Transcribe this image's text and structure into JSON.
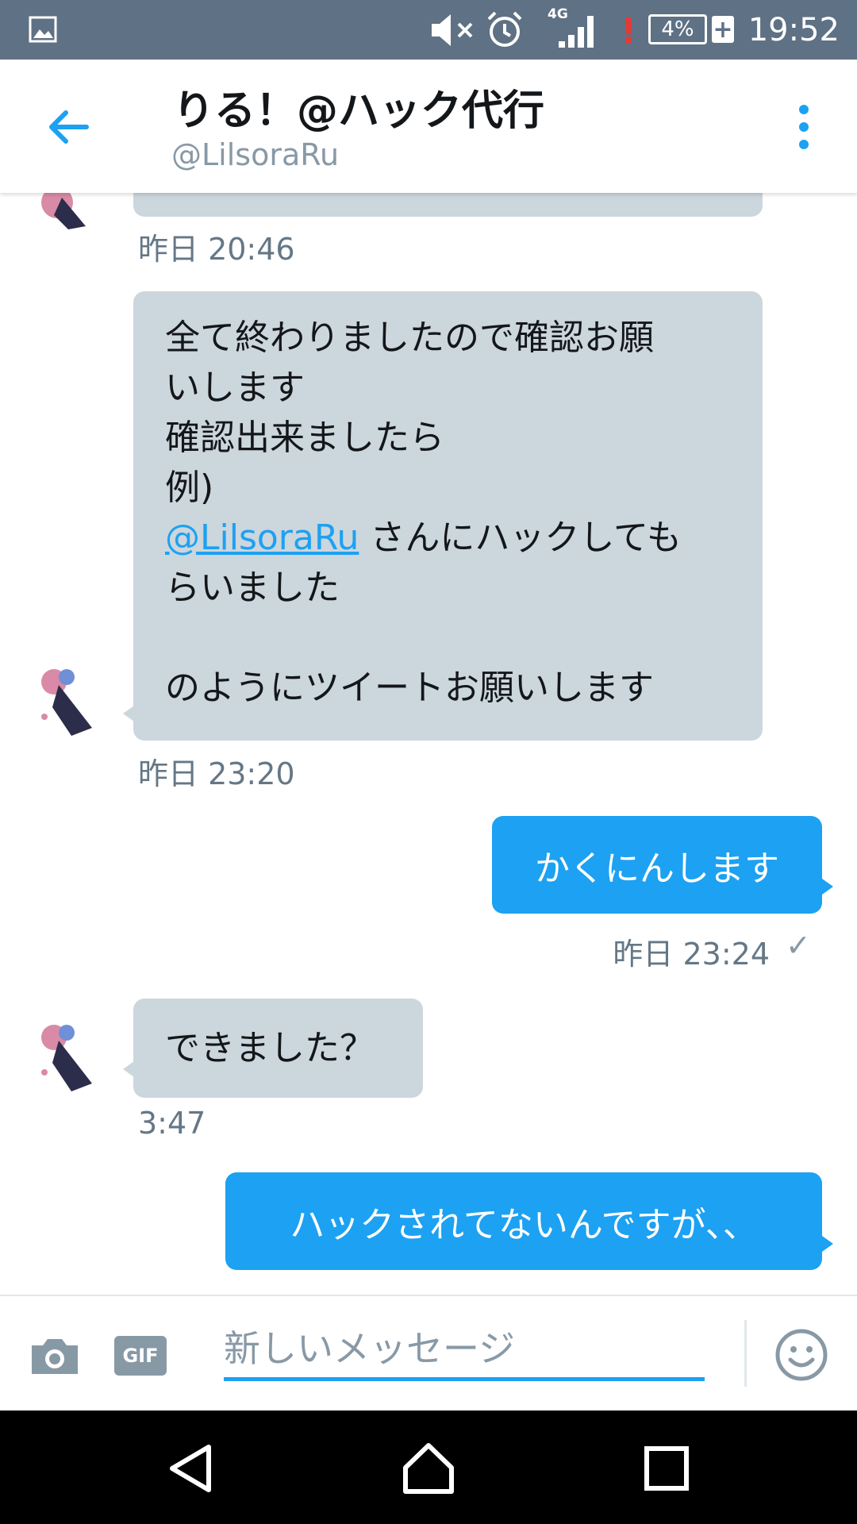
{
  "status_bar": {
    "network": "4G",
    "battery": "4%",
    "battery_charging": "+",
    "alert": "!",
    "time": "19:52"
  },
  "header": {
    "title": "りる！@ハック代行",
    "handle": "@LilsoraRu"
  },
  "messages": [
    {
      "direction": "incoming",
      "lines": [
        "全て終わりましたので確認お願",
        "いします",
        "確認出来ましたら",
        "例)"
      ],
      "mention": "@LilsoraRu",
      "after_mention": "さんにハックしても",
      "lines_after": [
        "らいました",
        "",
        "のようにツイートお願いします"
      ],
      "timestamp": "昨日 23:20"
    },
    {
      "direction": "outgoing",
      "text": "かくにんします",
      "timestamp": "昨日 23:24",
      "read_mark": "✓"
    },
    {
      "direction": "incoming",
      "text": "できました？",
      "timestamp": "3:47"
    },
    {
      "direction": "outgoing",
      "text": "ハックされてないんですが、、"
    }
  ],
  "previous_timestamp": "昨日 20:46",
  "composer": {
    "gif_label": "GIF",
    "placeholder": "新しいメッセージ"
  },
  "colors": {
    "status_bar": "#5f7184",
    "accent": "#1da1f2",
    "incoming_bubble": "#ccd6dd",
    "secondary_text": "#657786"
  }
}
